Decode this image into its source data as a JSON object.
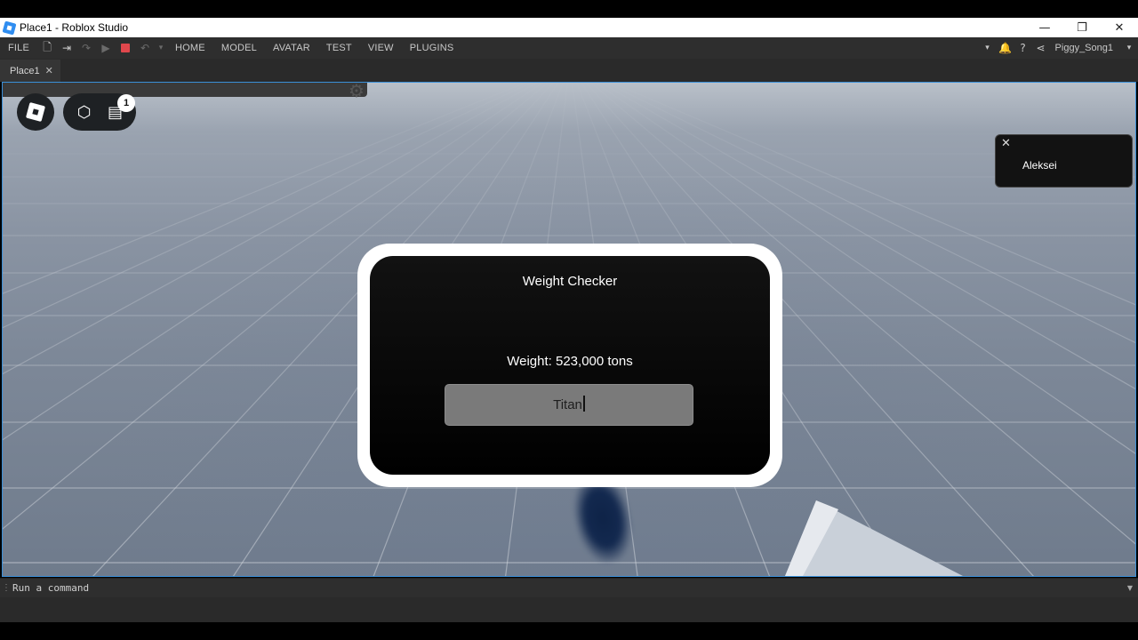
{
  "window": {
    "title": "Place1 - Roblox Studio",
    "controls": [
      "—",
      "❐",
      "✕"
    ]
  },
  "menubar": {
    "file": "FILE",
    "tabs": [
      "HOME",
      "MODEL",
      "AVATAR",
      "TEST",
      "VIEW",
      "PLUGINS"
    ],
    "username": "Piggy_Song1"
  },
  "doc_tab": {
    "label": "Place1",
    "close": "✕"
  },
  "game": {
    "badge_count": "1",
    "toast": {
      "name": "Aleksei",
      "close": "✕"
    },
    "dialog": {
      "title": "Weight Checker",
      "weight_text": "Weight: 523,000 tons",
      "input_value": "Titan"
    }
  },
  "command_bar": {
    "placeholder": "Run a command"
  },
  "colors": {
    "accent": "#3a8fd8",
    "stop": "#e0474c",
    "dialog_bg": "#000000",
    "input_bg": "#7a7a7a"
  }
}
